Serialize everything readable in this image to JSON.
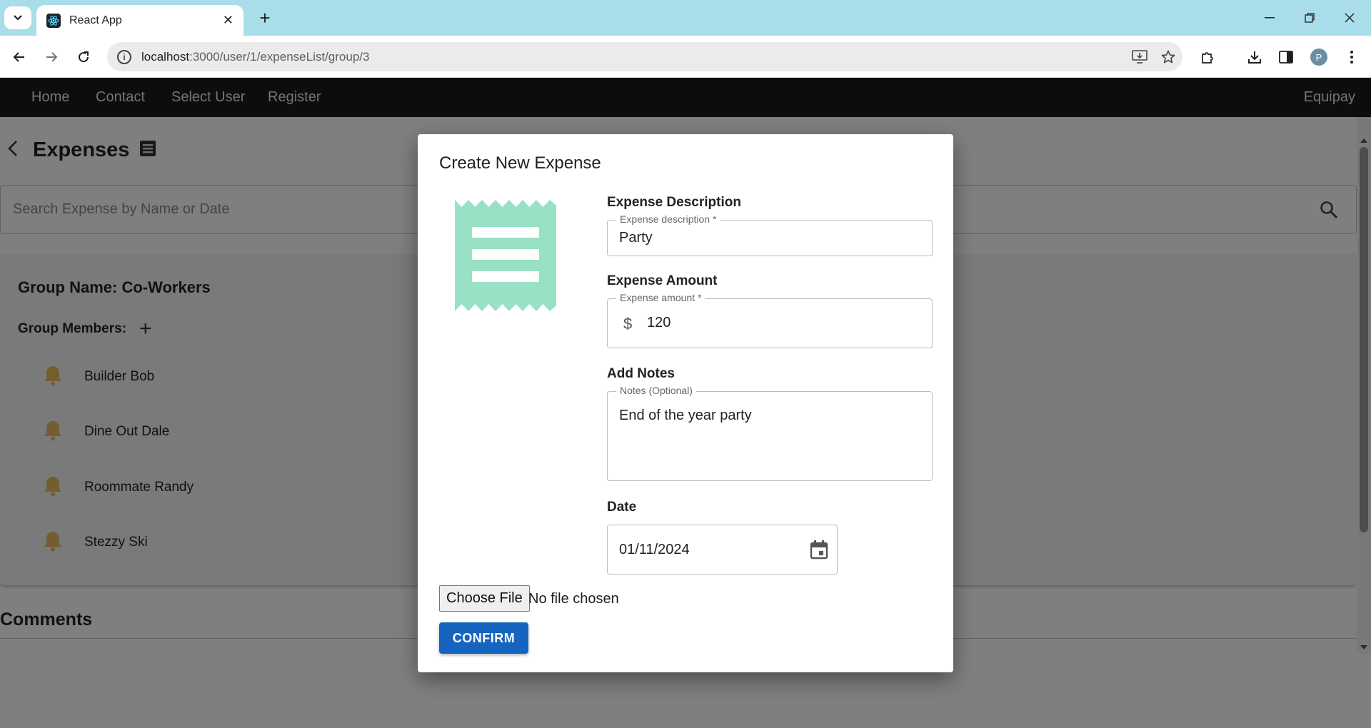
{
  "browser": {
    "tab_title": "React App",
    "url_host": "localhost",
    "url_path": ":3000/user/1/expenseList/group/3",
    "profile_initial": "P"
  },
  "nav": {
    "items": [
      "Home",
      "Contact",
      "Select User",
      "Register"
    ],
    "brand": "Equipay"
  },
  "page": {
    "title": "Expenses",
    "search_placeholder": "Search Expense by Name or Date",
    "group_name": "Group Name: Co-Workers",
    "group_members_label": "Group Members:",
    "members": [
      "Builder Bob",
      "Dine Out Dale",
      "Roommate Randy",
      "Stezzy Ski"
    ],
    "comments_title": "Comments"
  },
  "modal": {
    "title": "Create New Expense",
    "description": {
      "heading": "Expense Description",
      "label": "Expense description *",
      "value": "Party"
    },
    "amount": {
      "heading": "Expense Amount",
      "label": "Expense amount *",
      "currency": "$",
      "value": "120"
    },
    "notes": {
      "heading": "Add Notes",
      "label": "Notes (Optional)",
      "value": "End of the year party"
    },
    "date": {
      "heading": "Date",
      "value": "01/11/2024"
    },
    "file_button": "Choose File",
    "file_status": "No file chosen",
    "confirm": "CONFIRM"
  },
  "colors": {
    "appbar": "#1b1b1b",
    "receipt": "#98e1c4",
    "bell": "#e6bc5e",
    "confirm": "#1565c0",
    "tabstrip": "#a9dde9"
  }
}
